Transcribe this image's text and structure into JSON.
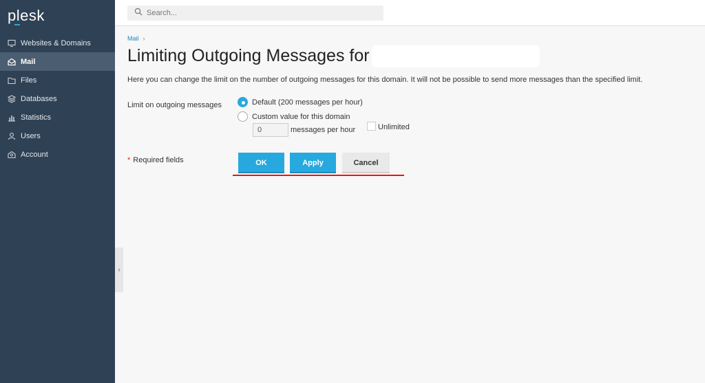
{
  "app": {
    "logo": "plesk"
  },
  "sidebar": {
    "items": [
      {
        "label": "Websites & Domains",
        "icon": "monitor-icon",
        "active": false
      },
      {
        "label": "Mail",
        "icon": "mail-icon",
        "active": true
      },
      {
        "label": "Files",
        "icon": "folder-icon",
        "active": false
      },
      {
        "label": "Databases",
        "icon": "database-icon",
        "active": false
      },
      {
        "label": "Statistics",
        "icon": "bar-chart-icon",
        "active": false
      },
      {
        "label": "Users",
        "icon": "user-icon",
        "active": false
      },
      {
        "label": "Account",
        "icon": "account-icon",
        "active": false
      }
    ]
  },
  "header": {
    "search_placeholder": "Search..."
  },
  "breadcrumb": {
    "item": "Mail",
    "separator": "›"
  },
  "page": {
    "title": "Limiting Outgoing Messages for",
    "description": "Here you can change the limit on the number of outgoing messages for this domain. It will not be possible to send more messages than the specified limit."
  },
  "form": {
    "field_label": "Limit on outgoing messages",
    "option_default": "Default (200 messages per hour)",
    "option_custom": "Custom value for this domain",
    "selected_option": "default",
    "custom_value": "0",
    "per_hour_label": "messages per hour",
    "unlimited_label": "Unlimited",
    "unlimited_checked": false,
    "required_star": "*",
    "required_label": "Required fields"
  },
  "buttons": {
    "ok": "OK",
    "apply": "Apply",
    "cancel": "Cancel"
  },
  "colors": {
    "accent": "#27a9e0",
    "sidebar": "#2f4155",
    "annotation": "#ee1111"
  }
}
